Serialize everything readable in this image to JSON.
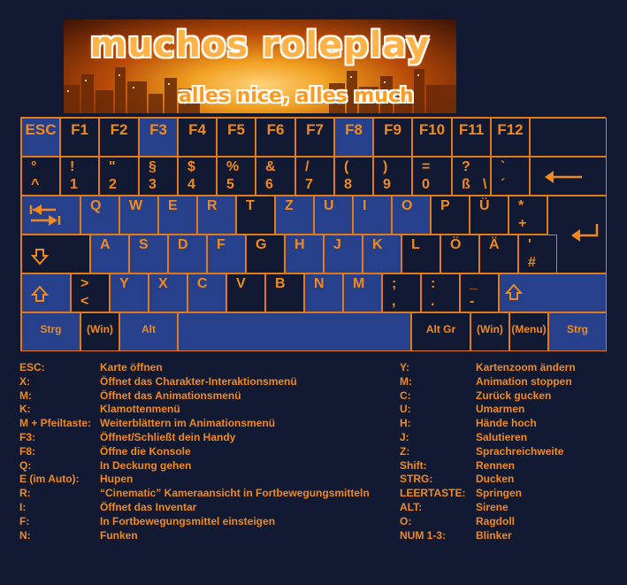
{
  "banner": {
    "title": "muchos roleplay",
    "subtitle": "alles nice, alles much"
  },
  "keyboard": {
    "fkeys": [
      "ESC",
      "F1",
      "F2",
      "F3",
      "F4",
      "F5",
      "F6",
      "F7",
      "F8",
      "F9",
      "F10",
      "F11",
      "F12"
    ],
    "num_row": [
      {
        "top": "°",
        "bottom": "^"
      },
      {
        "top": "!",
        "bottom": "1"
      },
      {
        "top": "\"",
        "bottom": "2"
      },
      {
        "top": "§",
        "bottom": "3"
      },
      {
        "top": "$",
        "bottom": "4"
      },
      {
        "top": "%",
        "bottom": "5"
      },
      {
        "top": "&",
        "bottom": "6"
      },
      {
        "top": "/",
        "bottom": "7"
      },
      {
        "top": "(",
        "bottom": "8"
      },
      {
        "top": ")",
        "bottom": "9"
      },
      {
        "top": "=",
        "bottom": "0"
      },
      {
        "top": "?",
        "bottom": "ß",
        "extra": "\\"
      },
      {
        "top": "`",
        "bottom": "´"
      }
    ],
    "qwertz_row": [
      "Q",
      "W",
      "E",
      "R",
      "T",
      "Z",
      "U",
      "I",
      "O",
      "P",
      "Ü"
    ],
    "plus_key": {
      "top": "*",
      "bottom": "+"
    },
    "asdf_row": [
      "A",
      "S",
      "D",
      "F",
      "G",
      "H",
      "J",
      "K",
      "L",
      "Ö",
      "Ä"
    ],
    "hash_key": {
      "top": "'",
      "bottom": "#"
    },
    "lt_key": {
      "top": ">",
      "bottom": "<"
    },
    "yxcv_row": [
      "Y",
      "X",
      "C",
      "V",
      "B",
      "N",
      "M"
    ],
    "punct_keys": [
      {
        "top": ";",
        "bottom": ","
      },
      {
        "top": ":",
        "bottom": "."
      },
      {
        "top": "_",
        "bottom": "-"
      }
    ],
    "bottom_row": {
      "strg_left": "Strg",
      "win_left": "(Win)",
      "alt": "Alt",
      "altgr": "Alt Gr",
      "win_right": "(Win)",
      "menu": "(Menu)",
      "strg_right": "Strg"
    },
    "icons": {
      "backspace": "arrow-left-icon",
      "tab": "tab-arrows-icon",
      "enter": "enter-arrow-icon",
      "capslock": "caps-arrow-icon",
      "shift": "shift-arrow-icon"
    },
    "colors": {
      "accent": "#f08a1e",
      "key_blue": "#27408b",
      "key_dark": "#121a33",
      "background": "#121a33"
    }
  },
  "legend_left": [
    {
      "key": "ESC:",
      "desc": "Karte öffnen"
    },
    {
      "key": "X:",
      "desc": "Öffnet das Charakter-Interaktionsmenü"
    },
    {
      "key": "M:",
      "desc": "Öffnet das Animationsmenü"
    },
    {
      "key": "K:",
      "desc": "Klamottenmenü"
    },
    {
      "key": "M + Pfeiltaste:",
      "desc": "Weiterblättern im Animationsmenü"
    },
    {
      "key": "F3:",
      "desc": "Öffnet/Schließt dein Handy"
    },
    {
      "key": "F8:",
      "desc": "Öffne die Konsole"
    },
    {
      "key": "Q:",
      "desc": "In Deckung gehen"
    },
    {
      "key": "E (im Auto):",
      "desc": "Hupen"
    },
    {
      "key": "R:",
      "desc": "“Cinematic” Kameraansicht in Fortbewegungsmitteln"
    },
    {
      "key": "I:",
      "desc": "Öffnet das Inventar"
    },
    {
      "key": "F:",
      "desc": "In Fortbewegungsmittel einsteigen"
    },
    {
      "key": "N:",
      "desc": "Funken"
    }
  ],
  "legend_right": [
    {
      "key": "Y:",
      "desc": "Kartenzoom ändern"
    },
    {
      "key": "M:",
      "desc": "Animation stoppen"
    },
    {
      "key": "C:",
      "desc": "Zurück gucken"
    },
    {
      "key": "U:",
      "desc": "Umarmen"
    },
    {
      "key": "H:",
      "desc": "Hände hoch"
    },
    {
      "key": "J:",
      "desc": "Salutieren"
    },
    {
      "key": "Z:",
      "desc": "Sprachreichweite"
    },
    {
      "key": "Shift:",
      "desc": "Rennen"
    },
    {
      "key": "STRG:",
      "desc": "Ducken"
    },
    {
      "key": "LEERTASTE:",
      "desc": "Springen"
    },
    {
      "key": "ALT:",
      "desc": "Sirene"
    },
    {
      "key": "O:",
      "desc": "Ragdoll"
    },
    {
      "key": "NUM 1-3:",
      "desc": "Blinker"
    }
  ]
}
